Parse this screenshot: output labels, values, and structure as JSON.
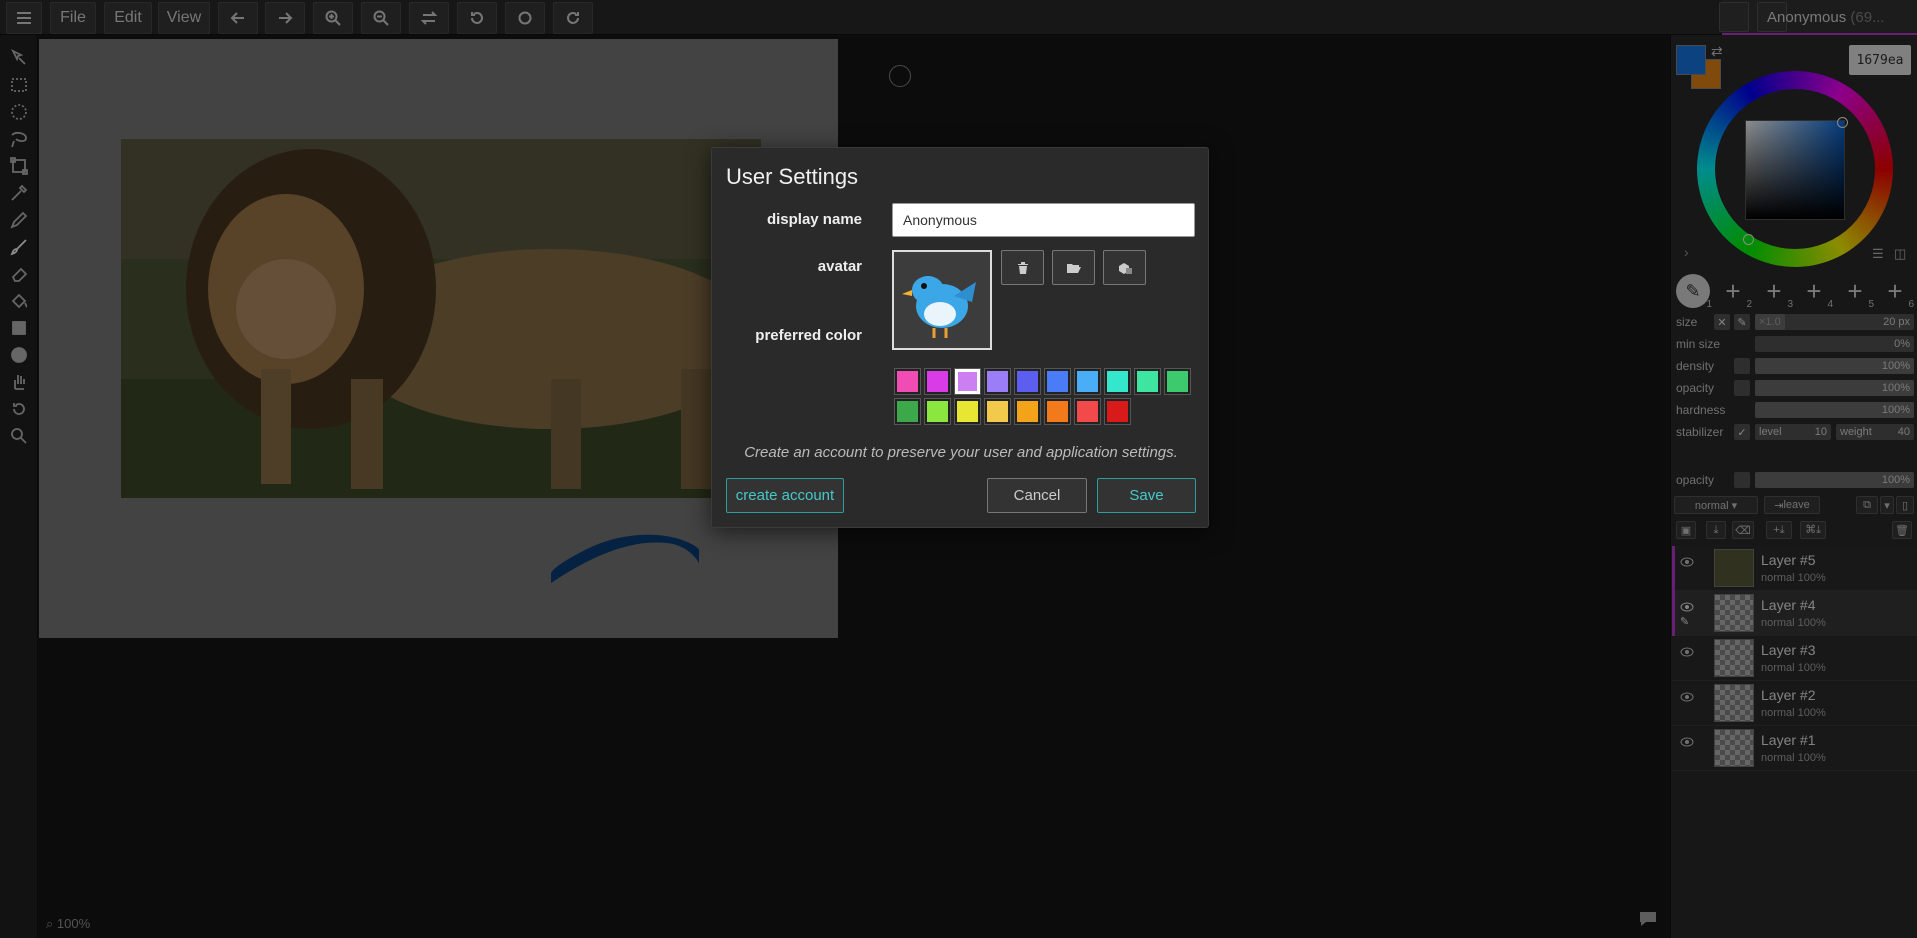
{
  "menu": {
    "file": "File",
    "edit": "Edit",
    "view": "View"
  },
  "user": {
    "name": "Anonymous",
    "name_suffix": "(69..."
  },
  "color": {
    "hex": "1679ea",
    "primary": "#1679ea",
    "secondary": "#ea8716"
  },
  "brush_slots": [
    "1",
    "2",
    "3",
    "4",
    "5",
    "6"
  ],
  "brush_props": {
    "size_label": "size",
    "size_mult": "×1.0",
    "size_val": "20 px",
    "min_size_label": "min size",
    "min_size_val": "0%",
    "density_label": "density",
    "density_val": "100%",
    "opacity_label": "opacity",
    "opacity_val": "100%",
    "hardness_label": "hardness",
    "hardness_val": "100%",
    "stabilizer_label": "stabilizer",
    "level_label": "level",
    "level_val": "10",
    "weight_label": "weight",
    "weight_val": "40"
  },
  "layer_props": {
    "opacity_label": "opacity",
    "opacity_val": "100%",
    "blend_mode": "normal ▾",
    "leave_label": "leave"
  },
  "layers": [
    {
      "name": "Layer #5",
      "mode": "normal  100%"
    },
    {
      "name": "Layer #4",
      "mode": "normal  100%"
    },
    {
      "name": "Layer #3",
      "mode": "normal  100%"
    },
    {
      "name": "Layer #2",
      "mode": "normal  100%"
    },
    {
      "name": "Layer #1",
      "mode": "normal  100%"
    }
  ],
  "canvas": {
    "zoom": "100%"
  },
  "dialog": {
    "title": "User Settings",
    "display_name_label": "display name",
    "display_name_value": "Anonymous",
    "avatar_label": "avatar",
    "preferred_color_label": "preferred color",
    "colors": [
      "#f04cb3",
      "#d93be6",
      "#cc7ff0",
      "#9b7df7",
      "#5c5ef0",
      "#4a7cf7",
      "#4aaef7",
      "#33e6cc",
      "#3de5a0",
      "#3dc96e",
      "#3da84a",
      "#8be640",
      "#e6e633",
      "#f2c94a",
      "#f2a31a",
      "#f27a1a",
      "#f24a4a",
      "#d91a1a"
    ],
    "selected_color": "#cc7ff0",
    "info": "Create an account to preserve your user and application settings.",
    "create_account": "create account",
    "cancel": "Cancel",
    "save": "Save"
  }
}
